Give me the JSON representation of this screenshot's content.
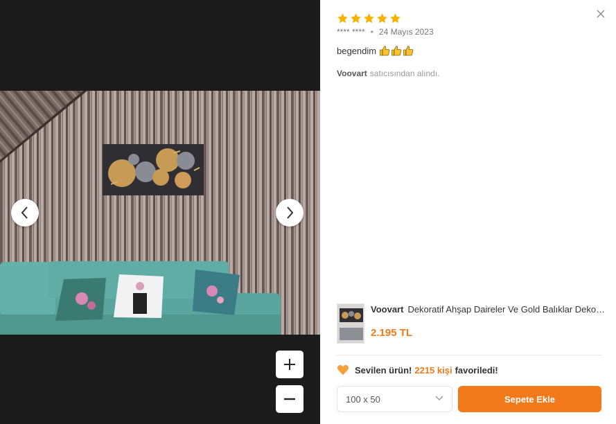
{
  "review": {
    "rating": 5,
    "rating_max": 5,
    "author": "**** ****",
    "date": "24 Mayıs 2023",
    "comment": "begendim",
    "thumbs_emoji": [
      "thumbs-up-icon",
      "thumbs-up-icon",
      "thumbs-up-icon"
    ],
    "seller_name": "Voovart",
    "seller_suffix": "satıcısından alındı."
  },
  "product": {
    "brand": "Voovart",
    "title": "Dekoratif Ahşap Daireler Ve Gold Balıklar Dekorasyon",
    "price": "2.195 TL"
  },
  "favorites": {
    "lead": "Sevilen ürün!",
    "count_text": "2215 kişi",
    "tail": "favoriledi!"
  },
  "actions": {
    "size_value": "100 x 50",
    "add_to_cart": "Sepete Ekle"
  },
  "viewer": {
    "icons": [
      "chevron-left-icon",
      "chevron-right-icon",
      "plus-icon",
      "minus-icon",
      "close-icon"
    ]
  },
  "colors": {
    "accent": "#f27a1a",
    "star": "#f5b301",
    "viewer_bg": "#1b1b1b"
  }
}
